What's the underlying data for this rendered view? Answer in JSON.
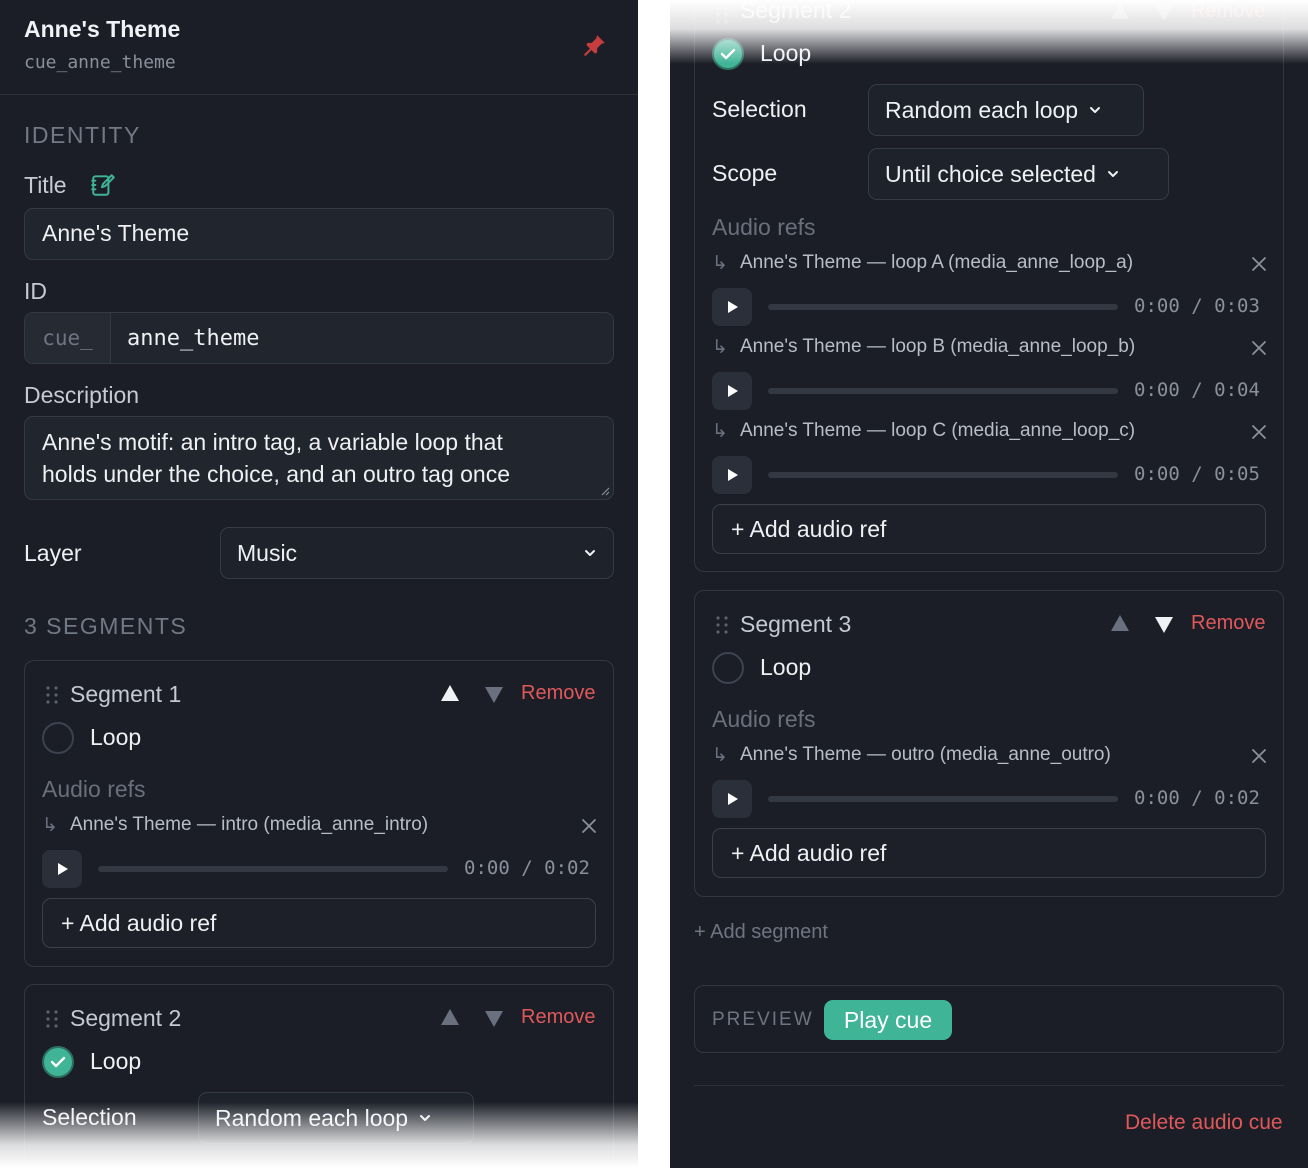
{
  "header": {
    "title": "Anne's Theme",
    "id": "cue_anne_theme"
  },
  "identity": {
    "heading": "IDENTITY",
    "title_label": "Title",
    "title_value": "Anne's Theme",
    "id_label": "ID",
    "id_prefix": "cue_",
    "id_value": "anne_theme",
    "description_label": "Description",
    "description_line1": "Anne's motif: an intro tag, a variable loop that",
    "description_line2": "holds under the choice, and an outro tag once",
    "layer_label": "Layer",
    "layer_value": "Music"
  },
  "segments_heading": "3 SEGMENTS",
  "common": {
    "loop_label": "Loop",
    "audio_refs_label": "Audio refs",
    "add_audio_ref": "+ Add audio ref",
    "remove_label": "Remove",
    "selection_label": "Selection",
    "scope_label": "Scope",
    "time_sep": "/"
  },
  "segments": [
    {
      "title": "Segment 1",
      "loop": false,
      "refs": [
        {
          "label": "Anne's Theme — intro (media_anne_intro)",
          "current": "0:00",
          "duration": "0:02"
        }
      ]
    },
    {
      "title": "Segment 2",
      "loop": true,
      "selection": "Random each loop",
      "scope": "Until choice selected",
      "refs": [
        {
          "label": "Anne's Theme — loop A (media_anne_loop_a)",
          "current": "0:00",
          "duration": "0:03"
        },
        {
          "label": "Anne's Theme — loop B (media_anne_loop_b)",
          "current": "0:00",
          "duration": "0:04"
        },
        {
          "label": "Anne's Theme — loop C (media_anne_loop_c)",
          "current": "0:00",
          "duration": "0:05"
        }
      ]
    },
    {
      "title": "Segment 3",
      "loop": false,
      "refs": [
        {
          "label": "Anne's Theme — outro (media_anne_outro)",
          "current": "0:00",
          "duration": "0:02"
        }
      ]
    }
  ],
  "add_segment": "+ Add segment",
  "preview": {
    "label": "PREVIEW",
    "button": "Play cue"
  },
  "delete_label": "Delete audio cue",
  "colors": {
    "background": "#1b1e26",
    "accent": "#3fb497",
    "danger": "#e0585a"
  },
  "icons": [
    "pin-icon",
    "edit-icon",
    "chevron-down-icon",
    "grip-icon",
    "arrow-up-icon",
    "arrow-down-icon",
    "check-icon",
    "close-icon",
    "play-icon",
    "corner-arrow-icon"
  ]
}
